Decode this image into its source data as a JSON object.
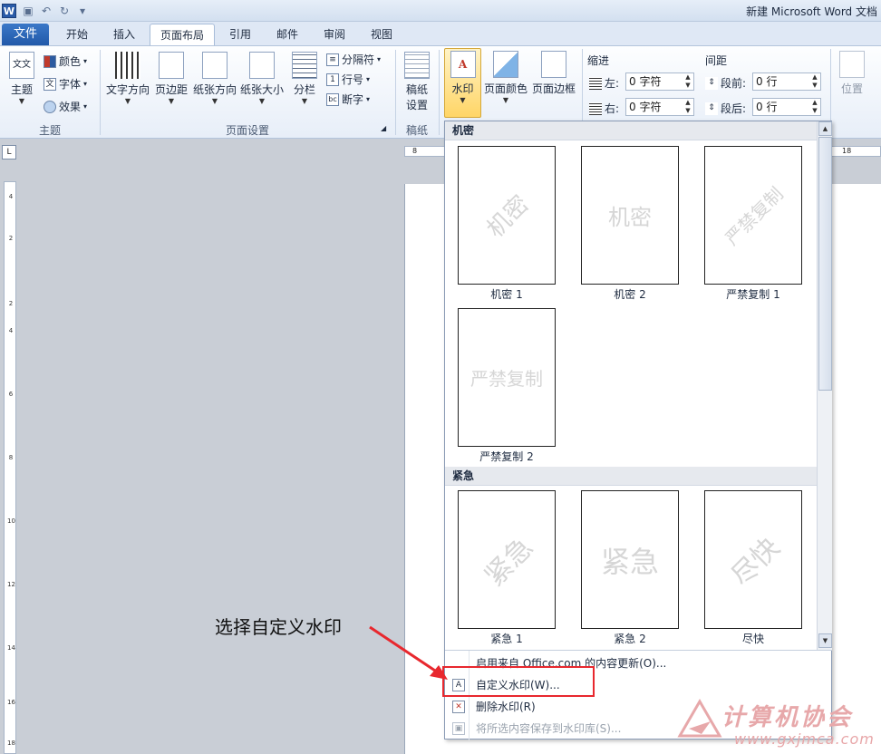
{
  "window": {
    "title": "新建 Microsoft Word 文档"
  },
  "tabs": [
    {
      "label": "文件"
    },
    {
      "label": "开始"
    },
    {
      "label": "插入"
    },
    {
      "label": "页面布局",
      "active": true
    },
    {
      "label": "引用"
    },
    {
      "label": "邮件"
    },
    {
      "label": "审阅"
    },
    {
      "label": "视图"
    }
  ],
  "ribbon": {
    "theme_group": {
      "label": "主题",
      "theme_button": "主题",
      "colors": "颜色",
      "fonts": "字体",
      "effects": "效果"
    },
    "page_setup_group": {
      "label": "页面设置",
      "text_direction": "文字方向",
      "margins": "页边距",
      "orientation": "纸张方向",
      "size": "纸张大小",
      "columns": "分栏",
      "breaks": "分隔符",
      "line_numbers": "行号",
      "hyphenation": "断字"
    },
    "draft_group": {
      "label": "稿纸",
      "button_line1": "稿纸",
      "button_line2": "设置"
    },
    "background_group": {
      "watermark": "水印",
      "page_color": "页面颜色",
      "page_borders": "页面边框"
    },
    "indent": {
      "title": "缩进",
      "left_label": "左:",
      "left_value": "0 字符",
      "right_label": "右:",
      "right_value": "0 字符"
    },
    "spacing": {
      "title": "间距",
      "before_label": "段前:",
      "before_value": "0 行",
      "after_label": "段后:",
      "after_value": "0 行"
    },
    "arrange": {
      "position": "位置"
    }
  },
  "watermark_gallery": {
    "sections": [
      {
        "title": "机密",
        "items": [
          {
            "label": "机密 1",
            "text": "机密",
            "style": "diagonal"
          },
          {
            "label": "机密 2",
            "text": "机密",
            "style": "horizontal"
          },
          {
            "label": "严禁复制 1",
            "text": "严禁复制",
            "style": "diagonal"
          },
          {
            "label": "严禁复制 2",
            "text": "严禁复制",
            "style": "horizontal"
          }
        ]
      },
      {
        "title": "紧急",
        "items": [
          {
            "label": "紧急 1",
            "text": "紧急",
            "style": "diagonal"
          },
          {
            "label": "紧急 2",
            "text": "紧急",
            "style": "horizontal"
          },
          {
            "label": "尽快",
            "text": "尽快",
            "style": "diagonal"
          }
        ]
      }
    ],
    "menu": [
      {
        "label": "启用来自 Office.com 的内容更新(O)...",
        "enabled": true
      },
      {
        "label": "自定义水印(W)...",
        "enabled": true,
        "icon": "custom-watermark-icon"
      },
      {
        "label": "删除水印(R)",
        "enabled": true,
        "icon": "remove-watermark-icon"
      },
      {
        "label": "将所选内容保存到水印库(S)...",
        "enabled": false,
        "icon": "save-to-gallery-icon"
      }
    ]
  },
  "annotation": {
    "text": "选择自定义水印",
    "highlight_color": "#e8282e"
  },
  "watermark_brand": {
    "text": "计算机协会",
    "url": "www.gxjmca.com"
  },
  "vertical_ruler": [
    "4",
    "2",
    "2",
    "4",
    "6",
    "8",
    "10",
    "12",
    "14",
    "16",
    "18"
  ],
  "horizontal_ruler_marks": [
    "8",
    "18"
  ]
}
